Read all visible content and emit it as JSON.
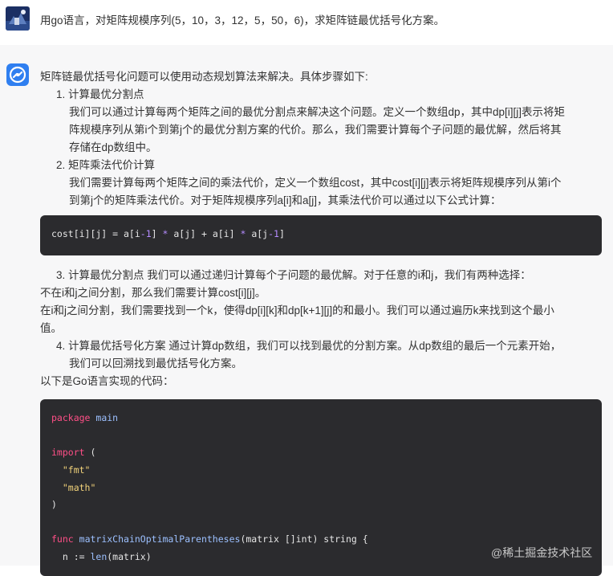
{
  "user": {
    "message": "用go语言，对矩阵规模序列(5，10，3，12，5，50，6)，求矩阵链最优括号化方案。",
    "avatar_icon": "user-avatar-icon"
  },
  "bot": {
    "avatar_icon": "bot-logo-icon",
    "intro": "矩阵链最优括号化问题可以使用动态规划算法来解决。具体步骤如下:",
    "step1_title": "1. 计算最优分割点",
    "step1_body": [
      "我们可以通过计算每两个矩阵之间的最优分割点来解决这个问题。定义一个数组dp，其中dp[i][j]表示将矩",
      "阵规模序列从第i个到第j个的最优分割方案的代价。那么，我们需要计算每个子问题的最优解，然后将其",
      "存储在dp数组中。"
    ],
    "step2_title": "2. 矩阵乘法代价计算",
    "step2_body": [
      "我们需要计算每两个矩阵之间的乘法代价，定义一个数组cost，其中cost[i][j]表示将矩阵规模序列从第i个",
      "到第j个的矩阵乘法代价。对于矩阵规模序列a[i]和a[j]，其乘法代价可以通过以下公式计算："
    ],
    "formula_code": {
      "part1": "cost[i][j] = a[i",
      "op1": "-1",
      "part2": "] ",
      "op2": "*",
      "part3": " a[j] + a[i] ",
      "op3": "*",
      "part4": " a[j",
      "op4": "-1",
      "part5": "]"
    },
    "step3_line": "3. 计算最优分割点 我们可以通过递归计算每个子问题的最优解。对于任意的i和j，我们有两种选择：",
    "choice1": "不在i和j之间分割，那么我们需要计算cost[i][j]。",
    "choice2_line1": "在i和j之间分割，我们需要找到一个k，使得dp[i][k]和dp[k+1][j]的和最小。我们可以通过遍历k来找到这个最小",
    "choice2_line2": "值。",
    "step4_line1": "4. 计算最优括号化方案 通过计算dp数组，我们可以找到最优的分割方案。从dp数组的最后一个元素开始，",
    "step4_line2": "我们可以回溯找到最优括号化方案。",
    "go_intro": "以下是Go语言实现的代码：",
    "go_code": {
      "pkg_kw": "package",
      "pkg_name": "main",
      "import_kw": "import",
      "import_open": " (",
      "imp1": "\"fmt\"",
      "imp2": "\"math\"",
      "import_close": ")",
      "func_kw": "func",
      "func_name": "matrixChainOptimalParentheses",
      "func_sig": "(matrix []int) string {",
      "line_n_var": "  n := ",
      "line_n_fn": "len",
      "line_n_arg": "(matrix)"
    }
  },
  "watermark": "@稀土掘金技术社区",
  "colors": {
    "code_bg": "#2b2b2e",
    "keyword": "#ff4f87",
    "string": "#f1d27a",
    "function": "#9cc0ff",
    "operator": "#b58cff",
    "bot_icon": "#2f7ff0",
    "panel_bg": "#f7f7f8"
  }
}
